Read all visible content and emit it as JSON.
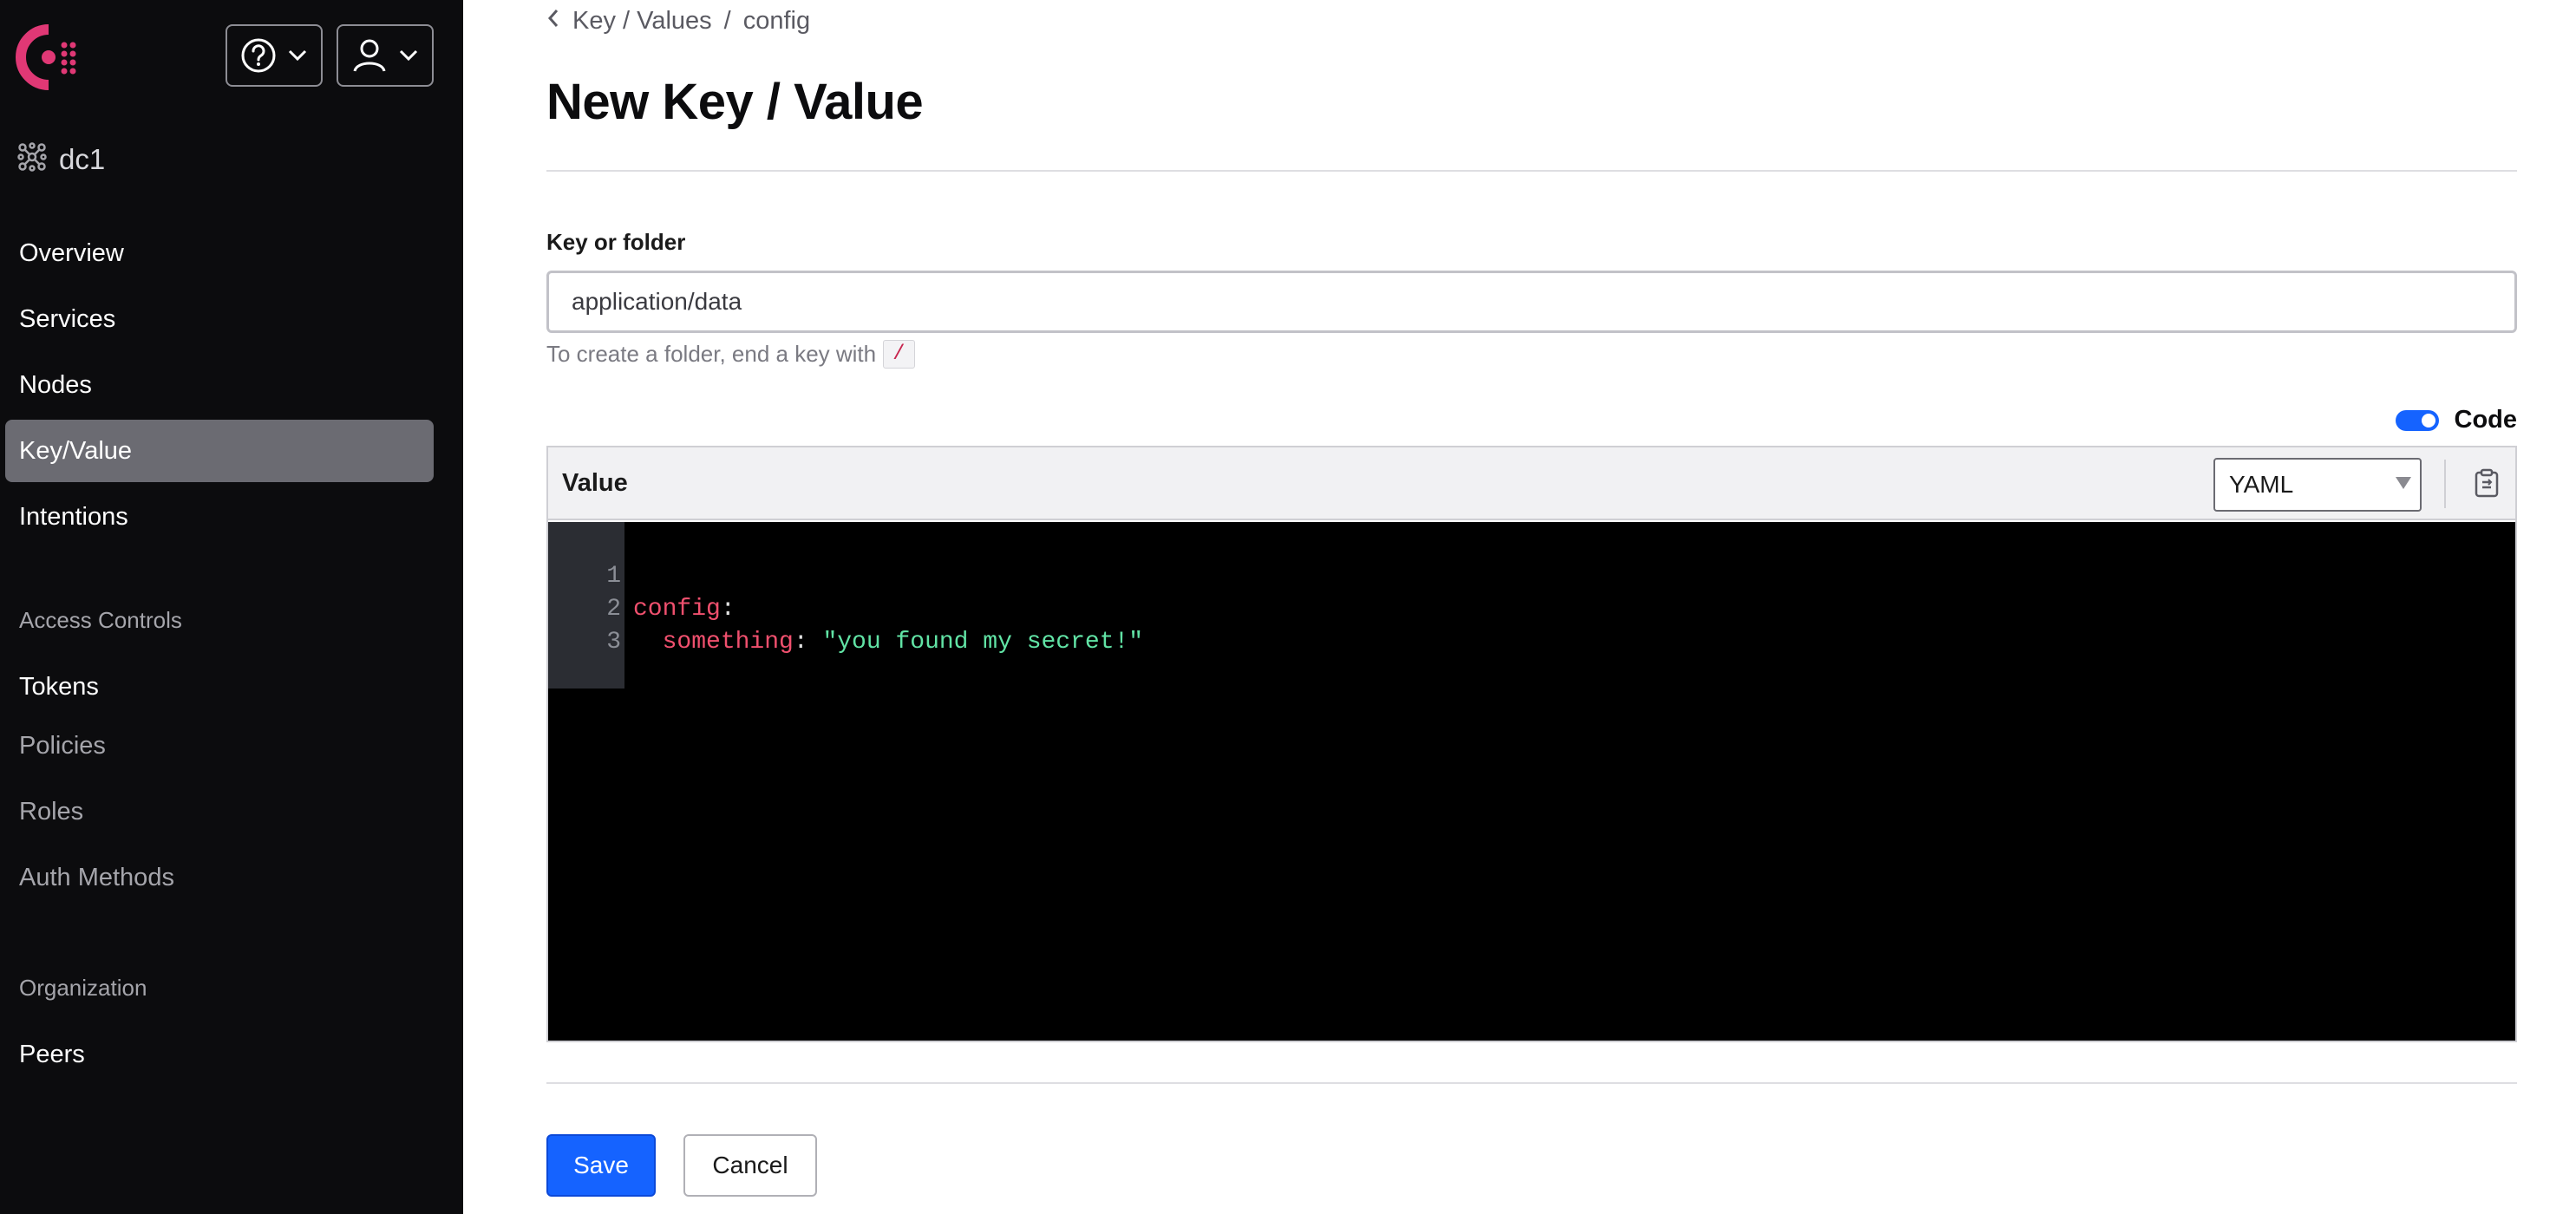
{
  "brand": {
    "accent": "#e03875",
    "icon": "consul-logo-icon"
  },
  "header": {
    "help_icon": "help-circle-icon",
    "user_icon": "user-icon",
    "chevron_icon": "chevron-down-icon"
  },
  "sidebar": {
    "datacenter": {
      "label": "dc1",
      "icon": "datacenter-icon"
    },
    "items": [
      {
        "label": "Overview"
      },
      {
        "label": "Services"
      },
      {
        "label": "Nodes"
      },
      {
        "label": "Key/Value",
        "active": true
      },
      {
        "label": "Intentions"
      }
    ],
    "access_controls": {
      "heading": "Access Controls",
      "items": [
        {
          "label": "Tokens"
        },
        {
          "label": "Policies"
        },
        {
          "label": "Roles"
        },
        {
          "label": "Auth Methods"
        }
      ]
    },
    "organization": {
      "heading": "Organization",
      "items": [
        {
          "label": "Peers"
        }
      ]
    }
  },
  "breadcrumb": {
    "back_icon": "chevron-left-icon",
    "parent": "Key / Values",
    "separator": "/",
    "current": "config"
  },
  "page": {
    "title": "New Key / Value"
  },
  "form": {
    "key_label": "Key or folder",
    "key_value": "application/data",
    "hint_text": "To create a folder, end a key with",
    "hint_code": "/",
    "code_toggle": {
      "label": "Code",
      "on": true,
      "color": "#1563ff"
    },
    "editor": {
      "title": "Value",
      "language": "YAML",
      "copy_icon": "clipboard-copy-icon",
      "lines": [
        {
          "number": "1",
          "key": "config",
          "punct": ":",
          "value": ""
        },
        {
          "number": "2",
          "key": "  something",
          "punct": ": ",
          "value": "\"you found my secret!\""
        },
        {
          "number": "3",
          "key": "",
          "punct": "",
          "value": ""
        }
      ]
    },
    "save_label": "Save",
    "cancel_label": "Cancel"
  }
}
